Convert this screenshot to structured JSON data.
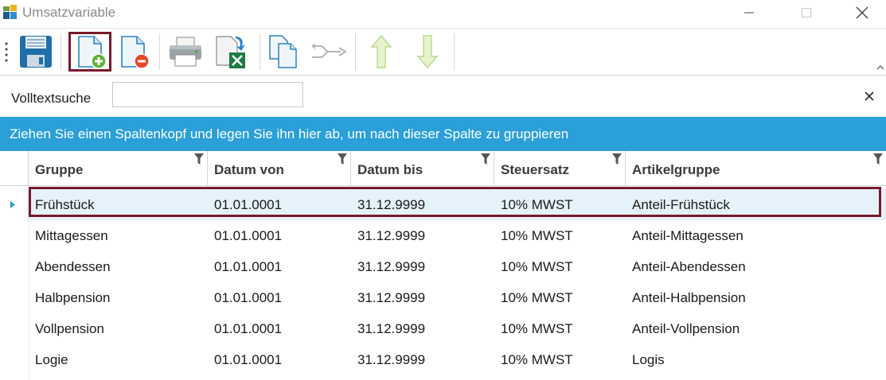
{
  "window": {
    "title": "Umsatzvariable"
  },
  "toolbar": {
    "buttons": [
      {
        "name": "save-button",
        "icon": "floppy-disk-icon"
      },
      {
        "name": "new-record-button",
        "icon": "document-add-icon",
        "active": true
      },
      {
        "name": "delete-record-button",
        "icon": "document-remove-icon"
      },
      {
        "name": "print-button",
        "icon": "printer-icon"
      },
      {
        "name": "export-excel-button",
        "icon": "excel-export-icon"
      },
      {
        "name": "copy-button",
        "icon": "copy-documents-icon"
      },
      {
        "name": "merge-button",
        "icon": "merge-arrows-icon"
      },
      {
        "name": "move-up-button",
        "icon": "arrow-up-icon"
      },
      {
        "name": "move-down-button",
        "icon": "arrow-down-icon"
      }
    ]
  },
  "search": {
    "label": "Volltextsuche",
    "value": "",
    "placeholder": ""
  },
  "grouppanel": {
    "text": "Ziehen Sie einen Spaltenkopf und legen Sie ihn hier ab, um nach dieser Spalte zu gruppieren"
  },
  "grid": {
    "columns": [
      "Gruppe",
      "Datum von",
      "Datum bis",
      "Steuersatz",
      "Artikelgruppe"
    ],
    "rows": [
      [
        "Frühstück",
        "01.01.0001",
        "31.12.9999",
        "10% MWST",
        "Anteil-Frühstück"
      ],
      [
        "Mittagessen",
        "01.01.0001",
        "31.12.9999",
        "10% MWST",
        "Anteil-Mittagessen"
      ],
      [
        "Abendessen",
        "01.01.0001",
        "31.12.9999",
        "10% MWST",
        "Anteil-Abendessen"
      ],
      [
        "Halbpension",
        "01.01.0001",
        "31.12.9999",
        "10% MWST",
        "Anteil-Halbpension"
      ],
      [
        "Vollpension",
        "01.01.0001",
        "31.12.9999",
        "10% MWST",
        "Anteil-Vollpension"
      ],
      [
        "Logie",
        "01.01.0001",
        "31.12.9999",
        "10% MWST",
        "Logis"
      ]
    ],
    "selected_row": 0
  },
  "colors": {
    "accent": "#2a9fd8",
    "highlight": "#7a1a2a",
    "selected_bg": "#e6f2fa"
  }
}
